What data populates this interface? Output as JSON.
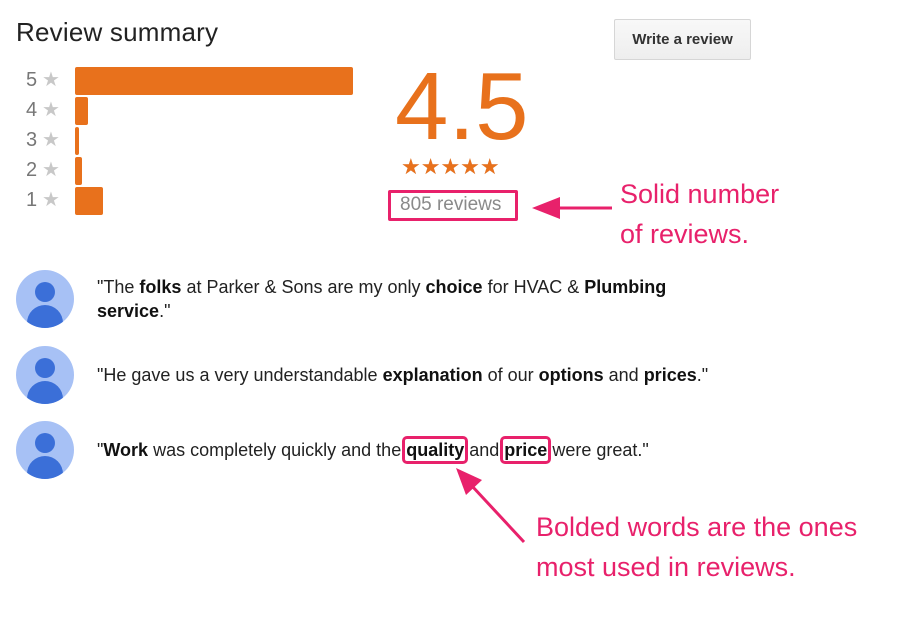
{
  "header": {
    "title": "Review summary",
    "write_review_label": "Write a review"
  },
  "rating_distribution": [
    {
      "stars_label": "5",
      "share": 1.0
    },
    {
      "stars_label": "4",
      "share": 0.045
    },
    {
      "stars_label": "3",
      "share": 0.015
    },
    {
      "stars_label": "2",
      "share": 0.025
    },
    {
      "stars_label": "1",
      "share": 0.1
    }
  ],
  "summary": {
    "score": "4.5",
    "star_rating": 4.5,
    "review_count_label": "805 reviews"
  },
  "annotations": {
    "reviews_note": [
      "Solid number",
      "of reviews."
    ],
    "bold_note": [
      "Bolded words are the ones",
      "most used in reviews."
    ]
  },
  "quotes": [
    {
      "segments": [
        {
          "t": "\"The "
        },
        {
          "t": "folks",
          "b": true
        },
        {
          "t": " at Parker & Sons are my only "
        },
        {
          "t": "choice",
          "b": true
        },
        {
          "t": " for HVAC & "
        },
        {
          "t": "Plumbing service",
          "b": true
        },
        {
          "t": ".\""
        }
      ]
    },
    {
      "segments": [
        {
          "t": "\"He gave us a very understandable "
        },
        {
          "t": "explanation",
          "b": true
        },
        {
          "t": " of our "
        },
        {
          "t": "options",
          "b": true
        },
        {
          "t": " and "
        },
        {
          "t": "prices",
          "b": true
        },
        {
          "t": ".\""
        }
      ]
    },
    {
      "segments": [
        {
          "t": "\""
        },
        {
          "t": "Work",
          "b": true
        },
        {
          "t": " was completely quickly and the "
        },
        {
          "t": "quality",
          "b": true,
          "hl": true
        },
        {
          "t": " and "
        },
        {
          "t": "price",
          "b": true,
          "hl": true
        },
        {
          "t": " were great.\""
        }
      ]
    }
  ],
  "colors": {
    "accent": "#e8711c",
    "annotation": "#e8216b",
    "avatar_bg": "#a7c1f5",
    "avatar_fg": "#3b6fd8"
  }
}
